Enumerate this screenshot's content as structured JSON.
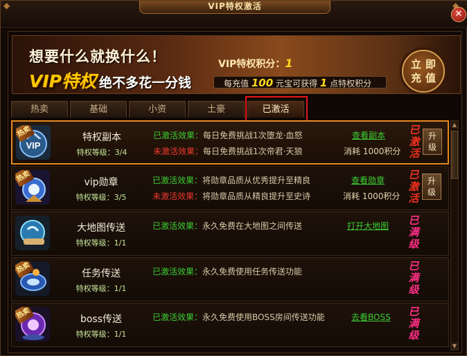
{
  "window": {
    "title": "VIP特权激活",
    "close_symbol": "✕"
  },
  "banner": {
    "slogan_top": "想要什么就换什么！",
    "vip_word": "VIP特权",
    "tagline": "绝不多花一分钱",
    "points_label": "VIP特权积分：",
    "points_value": "1",
    "rate_prefix": "每充值",
    "rate_amount": "100",
    "rate_middle": "元宝可获得",
    "rate_points": "1",
    "rate_suffix": "点特权积分",
    "recharge_line1": "立即",
    "recharge_line2": "充值"
  },
  "tabs": [
    {
      "label": "热卖"
    },
    {
      "label": "基础"
    },
    {
      "label": "小资"
    },
    {
      "label": "土豪"
    },
    {
      "label": "已激活"
    }
  ],
  "active_tab": "已激活",
  "labels": {
    "activated_effect": "已激活效果：",
    "inactive_effect": "未激活效果：",
    "upgrade_line1": "升",
    "upgrade_line2": "级",
    "hot_badge": "热卖"
  },
  "rows": [
    {
      "name": "特权副本",
      "level": "特权等级：3/4",
      "effect_on": "每日免费挑战1次堕龙·血怒",
      "effect_off": "每日免费挑战1次帝君·天狼",
      "link": "查看副本",
      "cost": "消耗 1000积分",
      "stamp": [
        "已",
        "激",
        "活"
      ],
      "hot": true,
      "icon": "vip-crest-icon"
    },
    {
      "name": "vip勋章",
      "level": "特权等级：3/5",
      "effect_on": "将勋章品质从优秀提升至精良",
      "effect_off": "将勋章品质从精良提升至史诗",
      "link": "查看勋章",
      "cost": "消耗 1000积分",
      "stamp": [
        "已",
        "激",
        "活"
      ],
      "hot": true,
      "icon": "medal-icon"
    },
    {
      "name": "大地图传送",
      "level": "特权等级：1/1",
      "effect_on": "永久免费在大地图之间传送",
      "link": "打开大地图",
      "stamp": [
        "已",
        "满",
        "级"
      ],
      "hot": false,
      "icon": "map-scroll-icon"
    },
    {
      "name": "任务传送",
      "level": "特权等级：1/1",
      "effect_on": "永久免费使用任务传送功能",
      "stamp": [
        "已",
        "满",
        "级"
      ],
      "hot": true,
      "icon": "portal-icon"
    },
    {
      "name": "boss传送",
      "level": "特权等级：1/1",
      "effect_on": "永久免费使用BOSS房间传送功能",
      "link": "去看BOSS",
      "stamp": [
        "已",
        "满",
        "级"
      ],
      "hot": true,
      "icon": "boss-orb-icon"
    }
  ],
  "scrollbar": {
    "up": "▲",
    "down": "▼"
  }
}
